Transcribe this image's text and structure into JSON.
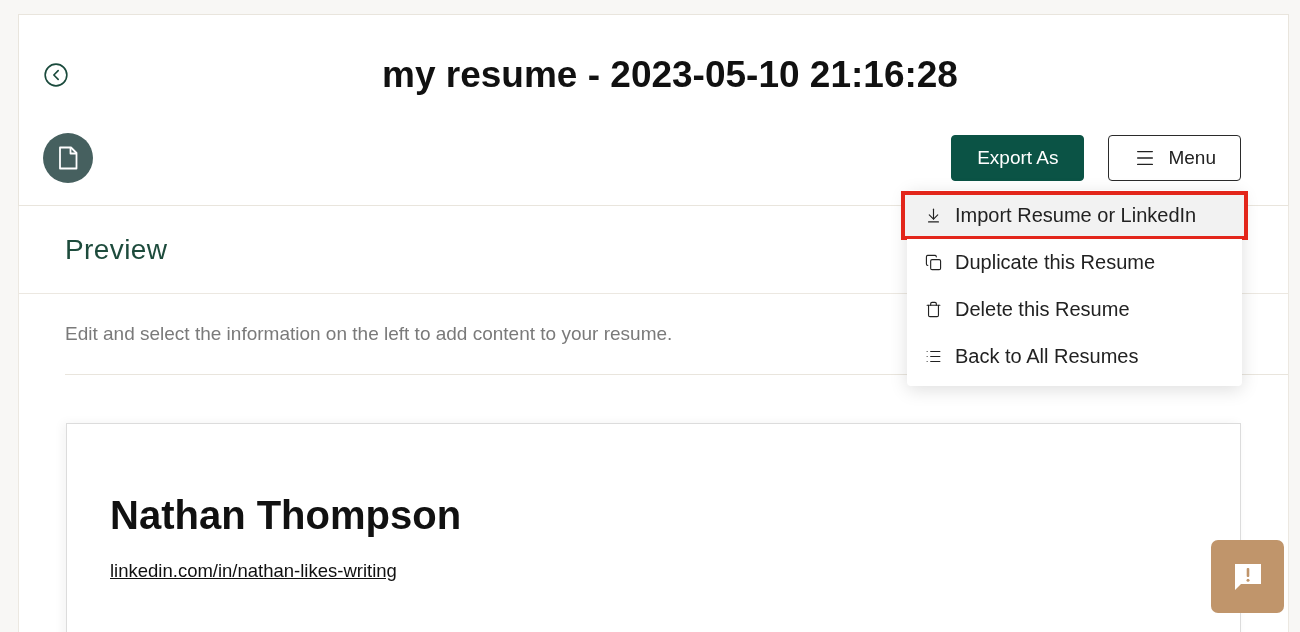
{
  "header": {
    "title": "my resume - 2023-05-10 21:16:28",
    "actions": [
      {
        "label": "Export As",
        "kind": "primary"
      },
      {
        "label": "Menu",
        "kind": "menu"
      }
    ]
  },
  "menu": {
    "expanded": true,
    "items": [
      {
        "label": "Import Resume or LinkedIn",
        "kind": "import",
        "highlighted": true
      },
      {
        "label": "Duplicate this Resume",
        "kind": "duplicate",
        "highlighted": false
      },
      {
        "label": "Delete this Resume",
        "kind": "delete",
        "highlighted": false
      },
      {
        "label": "Back to All Resumes",
        "kind": "list",
        "highlighted": false
      }
    ]
  },
  "preview": {
    "heading": "Preview",
    "hint": "Edit and select the information on the left to add content to your resume."
  },
  "resume": {
    "name": "Nathan Thompson",
    "link": "linkedin.com/in/nathan-likes-writing"
  }
}
